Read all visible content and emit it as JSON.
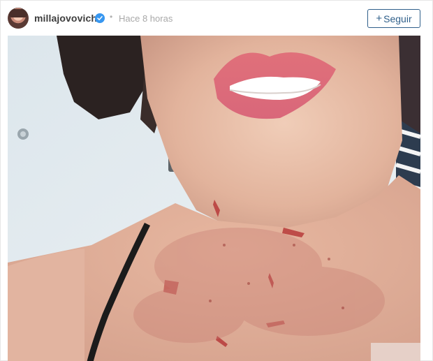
{
  "post": {
    "username": "millajovovich",
    "verified": true,
    "separator": "•",
    "timestamp": "Hace 8 horas",
    "follow_label": "Seguir",
    "follow_icon": "plus-icon"
  },
  "photo": {
    "subject": "selfie-close-up-neck-with-stage-makeup-wounds"
  },
  "colors": {
    "username": "#3d3d3d",
    "timestamp": "#a8a8a8",
    "verified_badge": "#3897f0",
    "follow_button": "#2f5f8a",
    "border": "#e6e6e6"
  }
}
